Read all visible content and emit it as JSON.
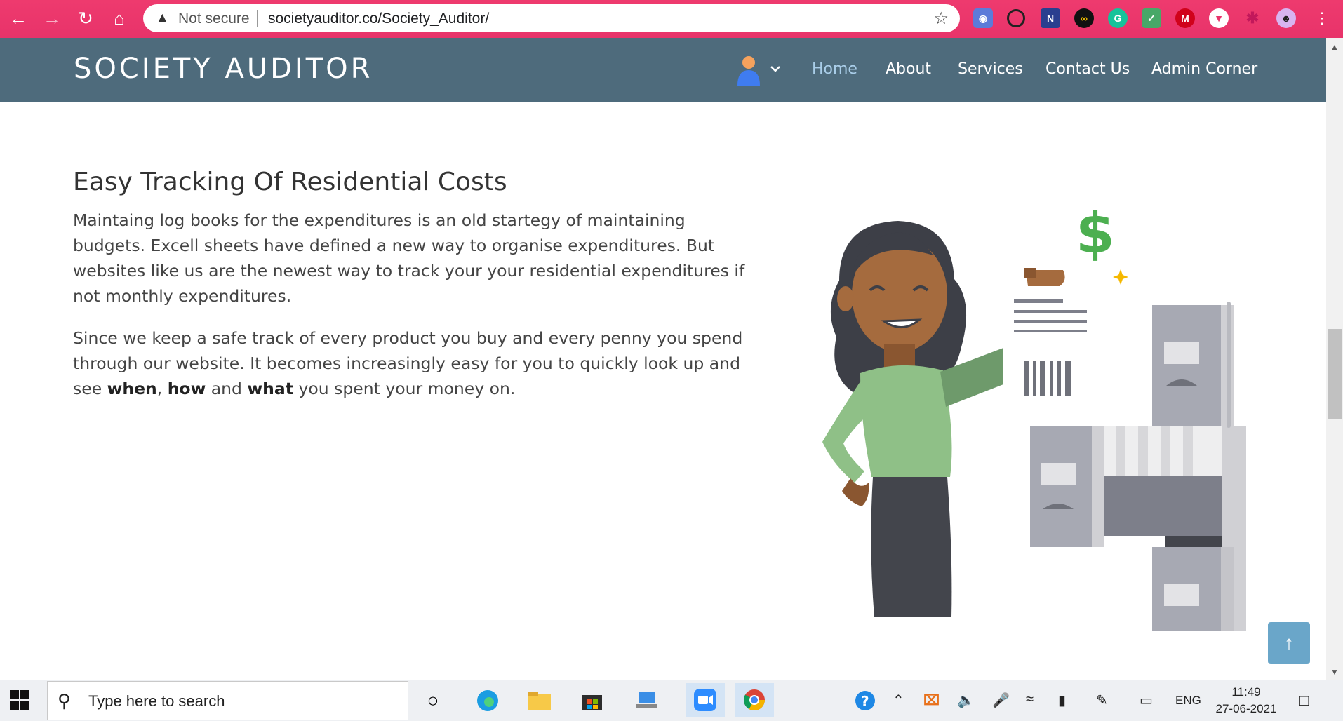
{
  "browser": {
    "security_label": "Not secure",
    "url": "societyauditor.co/Society_Auditor/",
    "extensions": [
      "camera-icon",
      "circle-icon",
      "n-icon",
      "infinity-icon",
      "grammarly-icon",
      "mail-check-icon",
      "m-icon",
      "shield-icon",
      "puzzle-icon",
      "profile-icon"
    ]
  },
  "site": {
    "brand": "SOCIETY AUDITOR",
    "nav": [
      "Home",
      "About",
      "Services",
      "Contact Us",
      "Admin Corner"
    ],
    "active_nav": "Home"
  },
  "content": {
    "heading": "Easy Tracking Of Residential Costs",
    "para1": "Maintaing log books for the expenditures is an old startegy of maintaining budgets. Excell sheets have defined a new way to organise expenditures. But websites like us are the newest way to track your your residential expenditures if not monthly expenditures.",
    "para2_start": "Since we keep a safe track of every product you buy and every penny you spend through our website. It becomes increasingly easy for you to quickly look up and see ",
    "bold_when": "when",
    "comma": ", ",
    "bold_how": "how",
    "and_text": " and ",
    "bold_what": "what",
    "para2_end": " you spent your money on.",
    "illustration_symbol": "$"
  },
  "taskbar": {
    "search_placeholder": "Type here to search",
    "language": "ENG",
    "time": "11:49",
    "date": "27-06-2021"
  },
  "colors": {
    "chrome": "#e8336a",
    "header": "#4e6b7c",
    "accent": "#6aa6c9"
  }
}
